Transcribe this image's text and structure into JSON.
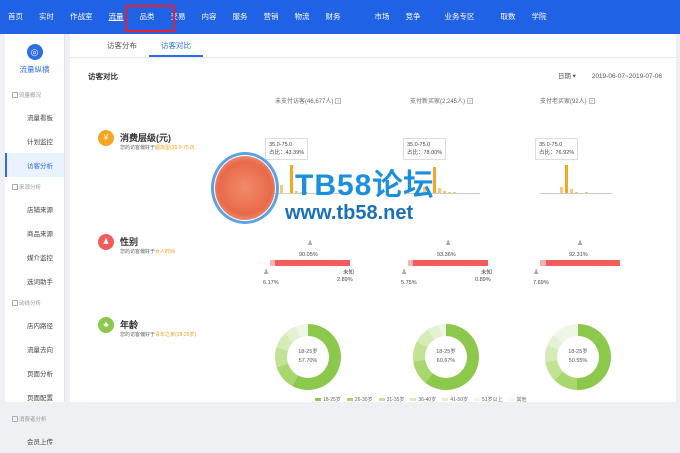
{
  "topnav": {
    "items": [
      "首页",
      "实时",
      "作战室",
      "流量",
      "品类",
      "交易",
      "内容",
      "服务",
      "营销",
      "物流",
      "财务",
      "市场",
      "竞争",
      "业务专区",
      "取数",
      "学院"
    ],
    "active_index": 3,
    "dot_indices": [
      4,
      7,
      9
    ]
  },
  "sidebar": {
    "title": "流量纵横",
    "groups": [
      {
        "label": "流量概况",
        "items": [
          "流量看板",
          "计划监控",
          "访客分析"
        ]
      },
      {
        "label": "来源分析",
        "items": [
          "店铺来源",
          "商品来源",
          "媒介监控",
          "选词助手"
        ]
      },
      {
        "label": "动线分析",
        "items": [
          "店内路径",
          "流量去向",
          "页面分析",
          "页面配置"
        ]
      },
      {
        "label": "消费者分析",
        "items": [
          "会员上传"
        ]
      }
    ],
    "active_item": "访客分析"
  },
  "tabs": [
    "访客分布",
    "访客对比"
  ],
  "active_tab": "访客对比",
  "panel": {
    "title": "访客对比",
    "granularity": "日期",
    "date_range": "2019-06-07~2019-07-06"
  },
  "columns": [
    "未支付访客(46,677人)",
    "支付新买家(2,245人)",
    "支付老买家(92人)"
  ],
  "consume": {
    "name": "消费层级(元)",
    "desc_prefix": "您的访客偏好于",
    "desc_hl": "超高型(35.0-75.0)",
    "tips": [
      [
        "35.0-75.0",
        "占比：43.39%"
      ],
      [
        "35.0-75.0",
        "占比：78.00%"
      ],
      [
        "35.0-75.0",
        "占比：76.92%"
      ]
    ]
  },
  "gender": {
    "name": "性别",
    "desc_prefix": "您的访客偏好于",
    "desc_hl": "女人时尚",
    "cols": [
      {
        "female": "90.05%",
        "male": "6.17%",
        "unknown_label": "未知",
        "unknown": "2.89%",
        "male_frac": 0.0617
      },
      {
        "female": "93.36%",
        "male": "5.75%",
        "unknown_label": "未知",
        "unknown": "0.89%",
        "male_frac": 0.0575
      },
      {
        "female": "92.31%",
        "male": "7.69%",
        "unknown_label": "",
        "unknown": "",
        "male_frac": 0.0769
      }
    ]
  },
  "age": {
    "name": "年龄",
    "desc_prefix": "您的访客偏好于",
    "desc_hl": "青年之家(18-25岁)",
    "cols": [
      {
        "label": "18-25岁",
        "value": "57.70%",
        "frac": 0.577
      },
      {
        "label": "18-25岁",
        "value": "60.67%",
        "frac": 0.6067
      },
      {
        "label": "18-25岁",
        "value": "50.55%",
        "frac": 0.5055
      }
    ],
    "legend": [
      "18-25岁",
      "26-30岁",
      "31-35岁",
      "36-40岁",
      "41-50岁",
      "51岁以上",
      "其他"
    ],
    "legend_colors": [
      "#8cc84b",
      "#a9d66e",
      "#c2e294",
      "#d6ebb8",
      "#e4f1d2",
      "#eef6e6",
      "#f4f8f0"
    ]
  },
  "watermark": {
    "text1": "TB58论坛",
    "text2": "www.tb58.net"
  },
  "colors": {
    "accent": "#2062e6",
    "orange": "#f5a623",
    "red": "#f45b5b",
    "green": "#8cc84b"
  }
}
